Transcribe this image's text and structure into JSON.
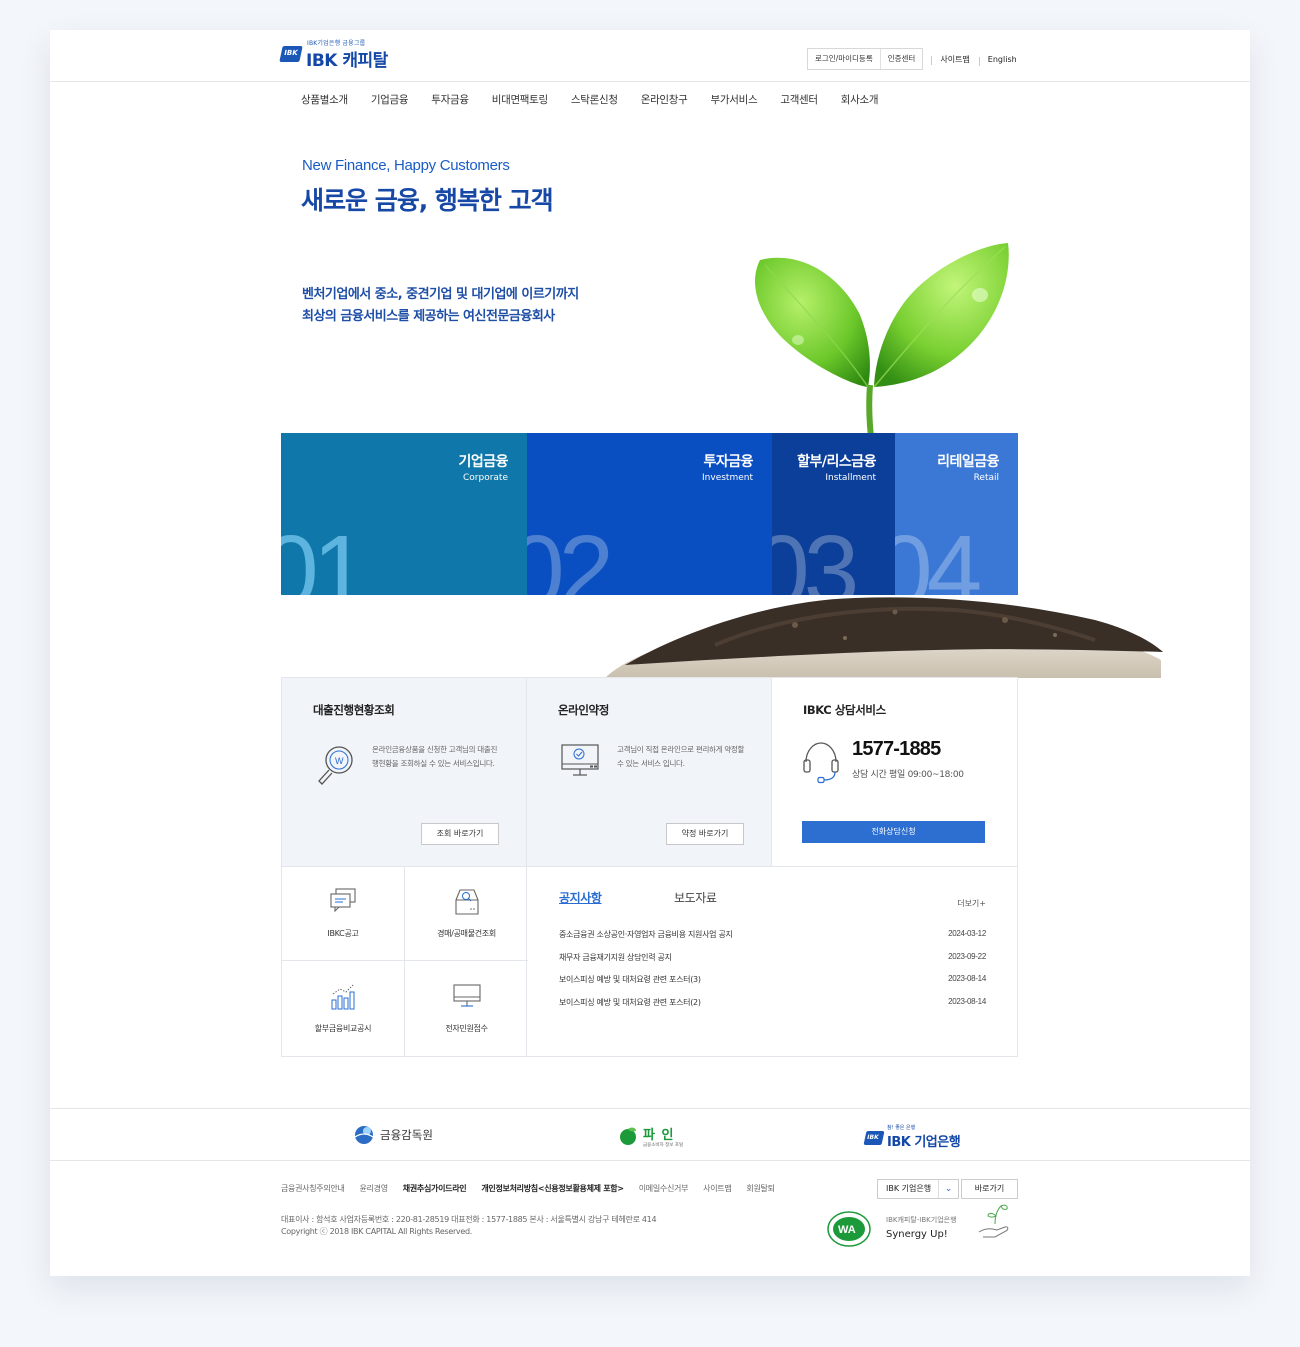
{
  "header": {
    "logo_tagline": "IBK기업은행 금융그룹",
    "logo_name": "IBK 캐피탈",
    "logo_badge": "IBK",
    "util_box": [
      "로그인/마이디등록",
      "인증센터"
    ],
    "sitemap": "사이트맵",
    "english": "English"
  },
  "gnb": [
    "상품별소개",
    "기업금융",
    "투자금융",
    "비대면팩토링",
    "스탁론신청",
    "온라인창구",
    "부가서비스",
    "고객센터",
    "회사소개"
  ],
  "hero": {
    "title_en": "New Finance, Happy Customers",
    "title_ko": "새로운 금융, 행복한 고객",
    "desc_line1": "벤처기업에서 중소, 중견기업 및 대기업에 이르기까지",
    "desc_line2": "최상의 금융서비스를 제공하는 여신전문금융회사"
  },
  "categories": [
    {
      "title": "기업금융",
      "subtitle": "Corporate",
      "num": "01"
    },
    {
      "title": "투자금융",
      "subtitle": "Investment",
      "num": "02"
    },
    {
      "title": "할부/리스금융",
      "subtitle": "Installment",
      "num": "03"
    },
    {
      "title": "리테일금융",
      "subtitle": "Retail",
      "num": "04"
    }
  ],
  "services": {
    "loan": {
      "title": "대출진행현황조회",
      "text": "온라인금융상품을 신청한 고객님의 대출진행현황을 조회하실 수 있는 서비스입니다.",
      "button": "조회 바로가기"
    },
    "agreement": {
      "title": "온라인약정",
      "text": "고객님이 직접 온라인으로 편리하게 약정할 수 있는 서비스 입니다.",
      "button": "약정 바로가기"
    },
    "consult": {
      "title": "IBKC 상담서비스",
      "phone": "1577-1885",
      "hours": "상담 시간 평일 09:00~18:00",
      "button": "전화상담신청"
    }
  },
  "quick_links": [
    "IBKC공고",
    "경매/공매물건조회",
    "할부금융비교공시",
    "전자민원접수"
  ],
  "notice": {
    "tab_active": "공지사항",
    "tab_inactive": "보도자료",
    "more": "더보기+",
    "items": [
      {
        "title": "중소금융권 소상공인·자영업자 금융비용 지원사업 공지",
        "date": "2024-03-12"
      },
      {
        "title": "채무자 금융재기지원 상담인력 공지",
        "date": "2023-09-22"
      },
      {
        "title": "보이스피싱 예방 및 대처요령 관련 포스터(3)",
        "date": "2023-08-14"
      },
      {
        "title": "보이스피싱 예방 및 대처요령 관련 포스터(2)",
        "date": "2023-08-14"
      }
    ]
  },
  "family": {
    "fss": "금융감독원",
    "fine": "파 인",
    "fine_sub": "금융소비자 정보 포털",
    "ibk_tag": "참! 좋은 은행",
    "ibk_badge": "IBK",
    "ibk": "IBK 기업은행"
  },
  "footer": {
    "links": [
      "금융권사칭주의안내",
      "윤리경영",
      "채권추심가이드라인",
      "개인정보처리방침<신용정보활용체제 포함>",
      "이메일수신거부",
      "사이트맵",
      "회원탈퇴"
    ],
    "bold_links": [
      false,
      false,
      true,
      true,
      false,
      false,
      false
    ],
    "select_value": "IBK 기업은행",
    "go_button": "바로가기",
    "info_line1": "대표이사 : 함석호    사업자등록번호 : 220-81-28519    대표전화 : 1577-1885    본사 : 서울특별시 강남구 테헤란로 414",
    "info_line2": "Copyright ⓒ 2018 IBK CAPITAL All Rights Reserved.",
    "wa_mark": "WA",
    "synergy_small": "IBK캐피탈-IBK기업은행",
    "synergy": "Synergy Up!"
  },
  "colors": {
    "brand_blue": "#1448a8",
    "accent_blue": "#2c6fd0",
    "tile_1": "#0f77a9",
    "tile_2": "#0a4fc1",
    "tile_3": "#0c3f99",
    "tile_4": "#3b78d6"
  },
  "icons": [
    "magnifier-w-icon",
    "monitor-check-icon",
    "headset-icon",
    "chat-bubbles-icon",
    "inbox-search-icon",
    "bar-chart-icon",
    "computer-icon",
    "sprout-image",
    "soil-image"
  ]
}
